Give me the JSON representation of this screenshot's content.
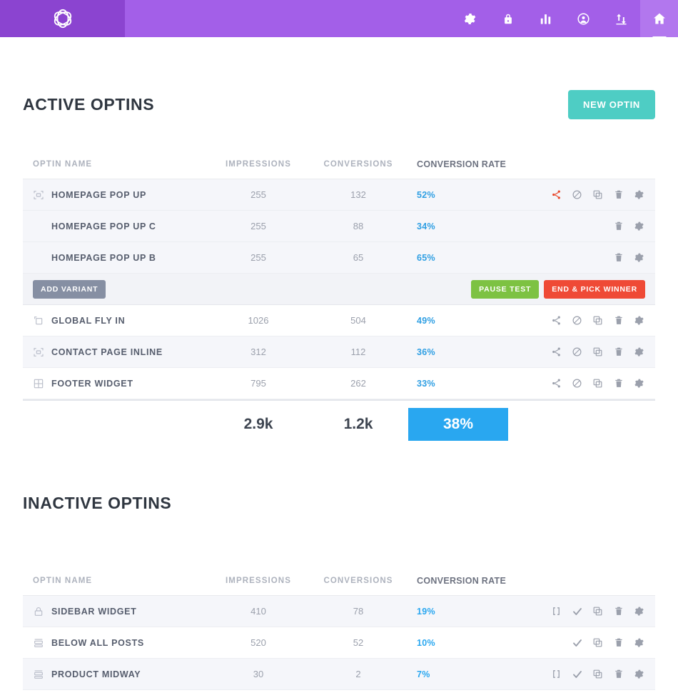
{
  "topbar": {
    "logo_icon": "knot-logo-icon",
    "nav": [
      {
        "icon": "gear-icon",
        "name": "settings",
        "active": false
      },
      {
        "icon": "lock-icon",
        "name": "security",
        "active": false
      },
      {
        "icon": "bar-chart-icon",
        "name": "analytics",
        "active": false
      },
      {
        "icon": "user-circle-icon",
        "name": "account",
        "active": false
      },
      {
        "icon": "sort-arrows-icon",
        "name": "transfer",
        "active": false
      },
      {
        "icon": "home-icon",
        "name": "dashboard",
        "active": true
      }
    ]
  },
  "colors": {
    "brand_purple_dark": "#8b44d0",
    "brand_purple": "#a35fe8",
    "brand_purple_light": "#b277ee",
    "accent_teal": "#4ecdc4",
    "accent_blue": "#29a7f0",
    "green": "#7dc242",
    "red": "#ef4a36",
    "gray_button": "#868fa3",
    "share_red": "#e8472a"
  },
  "active_section": {
    "title": "ACTIVE OPTINS",
    "new_button_label": "NEW OPTIN",
    "columns": {
      "name": "OPTIN NAME",
      "impressions": "IMPRESSIONS",
      "conversions": "CONVERSIONS",
      "rate": "CONVERSION RATE"
    },
    "rows": [
      {
        "name": "HOMEPAGE POP UP",
        "impressions": "255",
        "conversions": "132",
        "rate": "52%",
        "type_icon": "lightbox-icon",
        "shaded": true,
        "variant": false,
        "actions": [
          "share-icon",
          "disable-icon",
          "duplicate-icon",
          "trash-icon",
          "gear-icon"
        ]
      },
      {
        "name": "HOMEPAGE POP UP C",
        "impressions": "255",
        "conversions": "88",
        "rate": "34%",
        "type_icon": "none",
        "shaded": true,
        "variant": true,
        "actions": [
          "trash-icon",
          "gear-icon"
        ]
      },
      {
        "name": "HOMEPAGE POP UP B",
        "impressions": "255",
        "conversions": "65",
        "rate": "65%",
        "type_icon": "none",
        "shaded": true,
        "variant": true,
        "actions": [
          "trash-icon",
          "gear-icon"
        ]
      }
    ],
    "variant_bar": {
      "add_variant_label": "ADD VARIANT",
      "pause_label": "PAUSE TEST",
      "end_label": "END & PICK WINNER"
    },
    "rows_after": [
      {
        "name": "GLOBAL FLY IN",
        "impressions": "1026",
        "conversions": "504",
        "rate": "49%",
        "type_icon": "flyin-icon",
        "shaded": false,
        "actions": [
          "share-plain-icon",
          "disable-icon",
          "duplicate-icon",
          "trash-icon",
          "gear-icon"
        ]
      },
      {
        "name": "CONTACT PAGE INLINE",
        "impressions": "312",
        "conversions": "112",
        "rate": "36%",
        "type_icon": "lightbox-icon",
        "shaded": true,
        "actions": [
          "share-plain-icon",
          "disable-icon",
          "duplicate-icon",
          "trash-icon",
          "gear-icon"
        ]
      },
      {
        "name": "FOOTER WIDGET",
        "impressions": "795",
        "conversions": "262",
        "rate": "33%",
        "type_icon": "grid-icon",
        "shaded": false,
        "actions": [
          "share-plain-icon",
          "disable-icon",
          "duplicate-icon",
          "trash-icon",
          "gear-icon"
        ]
      }
    ],
    "totals": {
      "impressions": "2.9k",
      "conversions": "1.2k",
      "rate": "38%"
    }
  },
  "inactive_section": {
    "title": "INACTIVE OPTINS",
    "columns": {
      "name": "OPTIN NAME",
      "impressions": "IMPRESSIONS",
      "conversions": "CONVERSIONS",
      "rate": "CONVERSION RATE"
    },
    "rows": [
      {
        "name": "SIDEBAR WIDGET",
        "impressions": "410",
        "conversions": "78",
        "rate": "19%",
        "type_icon": "lock-icon",
        "shaded": true,
        "actions": [
          "shortcode-icon",
          "check-icon",
          "duplicate-icon",
          "trash-icon",
          "gear-icon"
        ]
      },
      {
        "name": "BELOW ALL POSTS",
        "impressions": "520",
        "conversions": "52",
        "rate": "10%",
        "type_icon": "stack-icon",
        "shaded": false,
        "actions": [
          "check-icon",
          "duplicate-icon",
          "trash-icon",
          "gear-icon"
        ]
      },
      {
        "name": "PRODUCT MIDWAY",
        "impressions": "30",
        "conversions": "2",
        "rate": "7%",
        "type_icon": "stack-icon",
        "shaded": true,
        "actions": [
          "shortcode-icon",
          "check-icon",
          "duplicate-icon",
          "trash-icon",
          "gear-icon"
        ]
      }
    ]
  }
}
